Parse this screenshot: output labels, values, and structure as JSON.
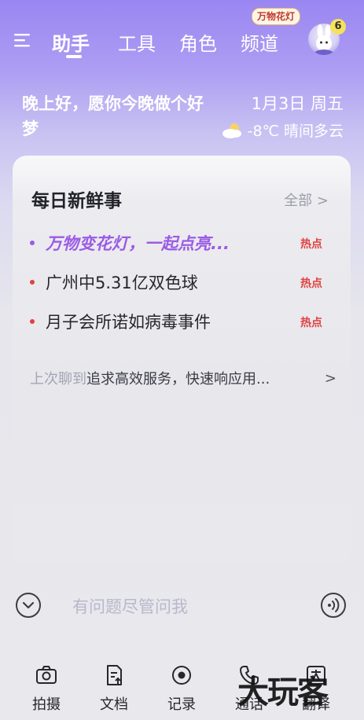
{
  "header": {
    "tabs": [
      {
        "label": "助手"
      },
      {
        "label": "工具"
      },
      {
        "label": "角色"
      },
      {
        "label": "频道"
      }
    ],
    "lantern_badge": "万物花灯",
    "avatar_count": "6"
  },
  "greeting": {
    "text": "晚上好，愿你今晚做个好梦",
    "date": "1月3日 周五",
    "weather": "-8℃ 晴间多云"
  },
  "card": {
    "title": "每日新鲜事",
    "all_label": "全部 >",
    "news": [
      {
        "text": "万物变花灯，一起点亮...",
        "tag": "热点"
      },
      {
        "text": "广州中5.31亿双色球",
        "tag": "热点"
      },
      {
        "text": "月子会所诺如病毒事件",
        "tag": "热点"
      }
    ],
    "last_chat": {
      "prefix": "上次聊到",
      "topic": "追求高效服务，快速响应用...",
      "arrow": ">"
    }
  },
  "input": {
    "placeholder": "有问题尽管问我"
  },
  "toolbar": {
    "items": [
      {
        "label": "拍摄",
        "icon": "camera-icon"
      },
      {
        "label": "文档",
        "icon": "document-upload-icon"
      },
      {
        "label": "记录",
        "icon": "record-icon"
      },
      {
        "label": "通话",
        "icon": "phone-call-icon"
      },
      {
        "label": "翻译",
        "icon": "translate-icon"
      }
    ]
  },
  "watermark": "大玩客",
  "colors": {
    "accent": "#9b5be6",
    "hot": "#e0413f",
    "header_gradient_top": "#9a86f2"
  }
}
